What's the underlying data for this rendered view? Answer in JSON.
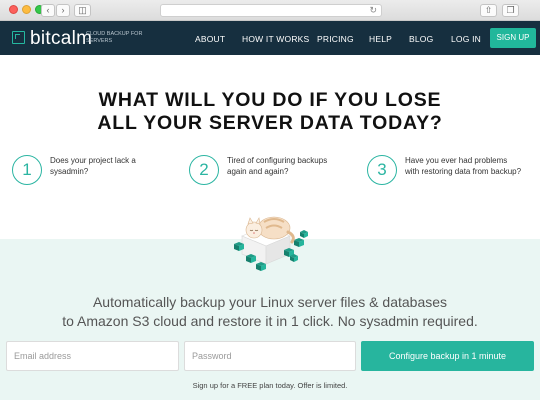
{
  "browser": {
    "back_icon": "chevron-left-icon",
    "forward_icon": "chevron-right-icon",
    "sidebar_icon": "sidebar-icon",
    "reload_icon": "reload-icon",
    "share_icon": "share-icon",
    "tabs_icon": "tabs-icon",
    "url": ""
  },
  "header": {
    "logo_text": "bitcalm",
    "tagline": "CLOUD BACKUP FOR SERVERS",
    "nav": [
      {
        "label": "ABOUT"
      },
      {
        "label": "HOW IT WORKS"
      },
      {
        "label": "PRICING"
      },
      {
        "label": "HELP"
      },
      {
        "label": "BLOG"
      },
      {
        "label": "LOG IN"
      }
    ],
    "signup_label": "SIGN UP"
  },
  "hero": {
    "headline_line1": "WHAT WILL YOU DO IF YOU LOSE",
    "headline_line2": "ALL YOUR SERVER DATA TODAY?"
  },
  "questions": [
    {
      "number": "1",
      "text": "Does your project lack a sysadmin?"
    },
    {
      "number": "2",
      "text": "Tired of configuring backups again and again?"
    },
    {
      "number": "3",
      "text": "Have you ever had problems with restoring data from backup?"
    }
  ],
  "signup_section": {
    "pitch_line1": "Automatically backup your Linux server files & databases",
    "pitch_line2": "to Amazon S3 cloud and restore it in 1 click. No sysadmin required.",
    "email_placeholder": "Email address",
    "password_placeholder": "Password",
    "cta_label": "Configure backup in 1 minute",
    "note": "Sign up for a FREE plan today. Offer is limited."
  },
  "colors": {
    "nav_bg": "#162f3f",
    "accent": "#27b59e",
    "band_bg": "#eaf6f3"
  }
}
